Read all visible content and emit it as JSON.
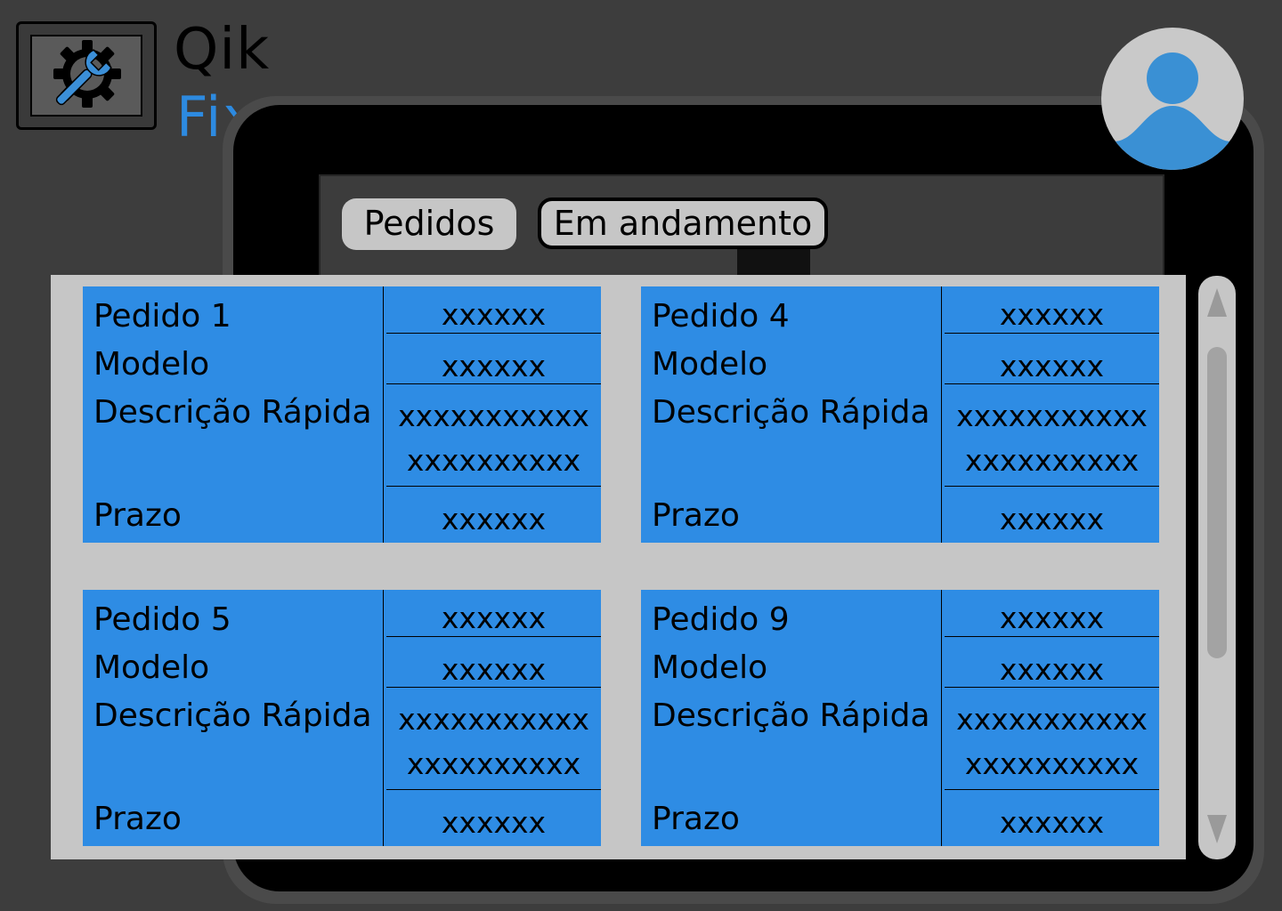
{
  "brand": {
    "line1": "Qik",
    "line2": "Fix"
  },
  "colors": {
    "accent": "#2e8ce4",
    "background": "#3d3d3d",
    "panel": "#c6c6c6"
  },
  "tabs": [
    {
      "label": "Pedidos"
    },
    {
      "label": "Em andamento"
    }
  ],
  "labels": {
    "model": "Modelo",
    "description": "Descrição Rápida",
    "deadline": "Prazo"
  },
  "cards": [
    {
      "title": "Pedido 1",
      "order_value": "xxxxxx",
      "model_value": "xxxxxx",
      "description_line1": "xxxxxxxxxxx",
      "description_line2": "xxxxxxxxxx",
      "deadline_value": "xxxxxx"
    },
    {
      "title": "Pedido 4",
      "order_value": "xxxxxx",
      "model_value": "xxxxxx",
      "description_line1": "xxxxxxxxxxx",
      "description_line2": "xxxxxxxxxx",
      "deadline_value": "xxxxxx"
    },
    {
      "title": "Pedido 5",
      "order_value": "xxxxxx",
      "model_value": "xxxxxx",
      "description_line1": "xxxxxxxxxxx",
      "description_line2": "xxxxxxxxxx",
      "deadline_value": "xxxxxx"
    },
    {
      "title": "Pedido 9",
      "order_value": "xxxxxx",
      "model_value": "xxxxxx",
      "description_line1": "xxxxxxxxxxx",
      "description_line2": "xxxxxxxxxx",
      "deadline_value": "xxxxxx"
    }
  ],
  "icons": {
    "logo": "gear-wrench-icon",
    "avatar": "user-icon",
    "scroll_up": "triangle-up-icon",
    "scroll_down": "triangle-down-icon"
  }
}
